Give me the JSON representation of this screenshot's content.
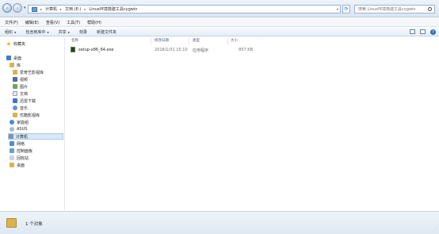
{
  "addressbar": {
    "crumbs": [
      "计算机",
      "文档 (E:)",
      "Linux环境搭建工具cygwin"
    ],
    "search_placeholder": "搜索 Linux环境搭建工具cygwin"
  },
  "menubar": {
    "items": [
      "文件(F)",
      "编辑(E)",
      "查看(V)",
      "工具(T)",
      "帮助(H)"
    ]
  },
  "toolbar": {
    "organize": "组织",
    "include_in_library": "包含到库中",
    "share": "共享",
    "burn": "刻录",
    "new_folder": "新建文件夹"
  },
  "navpane": {
    "favorites": "收藏夹",
    "desktop": "桌面",
    "library": "库",
    "library_items": [
      "爱奇艺影视库",
      "视频",
      "图片",
      "文档",
      "迅雷下载",
      "音乐",
      "优酷影视库"
    ],
    "homegroup": "家庭组",
    "user": "ASUS",
    "computer": "计算机",
    "network": "网络",
    "control_panel": "控制面板",
    "recycle_bin": "回收站",
    "desktop2": "桌面"
  },
  "columns": {
    "name": "名称",
    "date": "修改日期",
    "type": "类型",
    "size": "大小"
  },
  "files": [
    {
      "name": "setup-x86_64.exe",
      "date": "2016/1/31 15:10",
      "type": "应用程序",
      "size": "857 KB"
    }
  ],
  "statusbar": {
    "count": "1 个对象"
  }
}
